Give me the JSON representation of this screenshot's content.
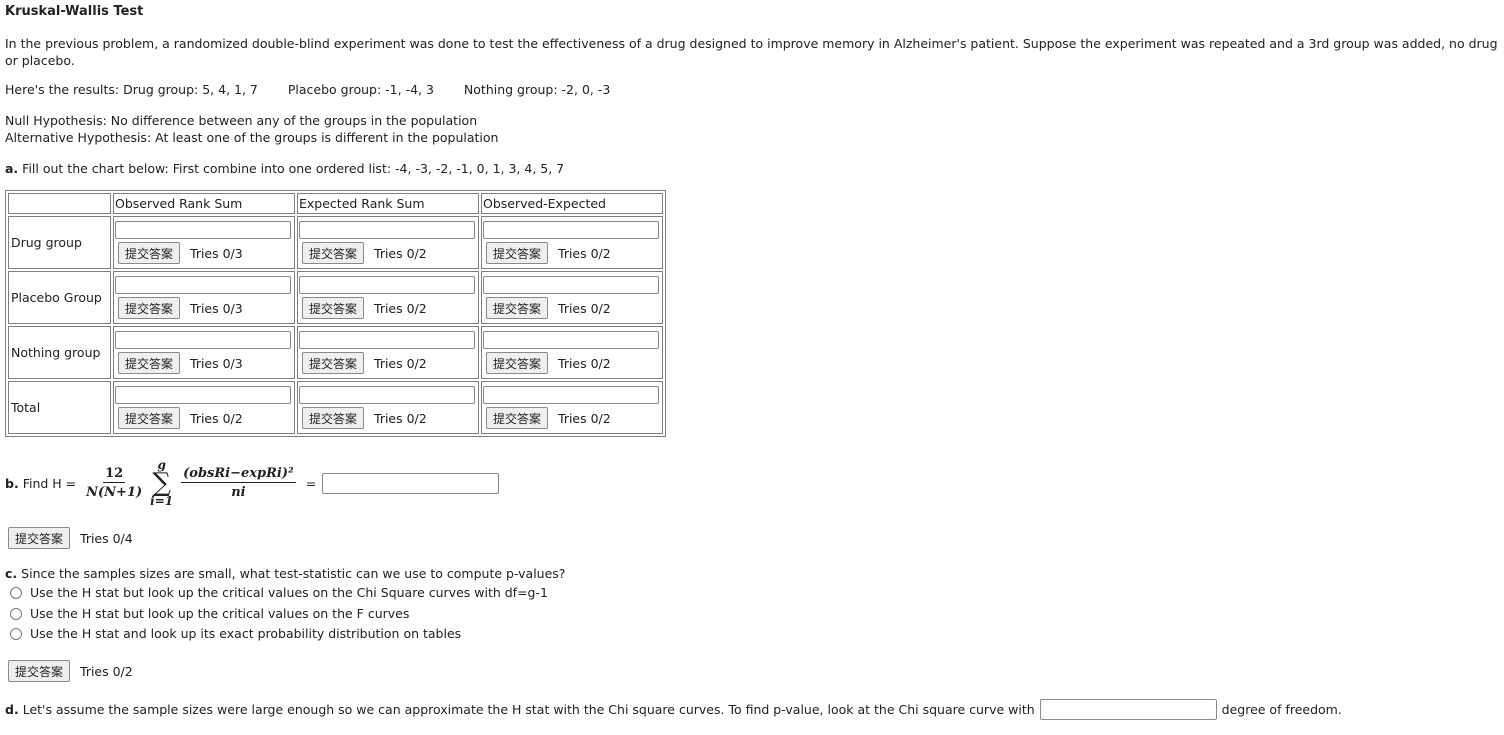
{
  "title": "Kruskal-Wallis Test",
  "intro": "In the previous problem, a randomized double-blind experiment was done to test the effectiveness of a drug designed to improve memory in Alzheimer's patient. Suppose the experiment was repeated and a 3rd group was added, no drug or placebo.",
  "results": {
    "prefix": "Here's the results:",
    "drug": "Drug group: 5, 4, 1, 7",
    "placebo": "Placebo group: -1, -4, 3",
    "nothing": "Nothing group: -2, 0, -3"
  },
  "hypotheses": {
    "null": "Null Hypothesis: No difference between any of the groups in the population",
    "alt": "Alternative Hypothesis: At least one of the groups is different in the population"
  },
  "part_a": {
    "label": "a.",
    "text": "Fill out the chart below: First combine into one ordered list: -4, -3, -2, -1, 0, 1, 3, 4, 5, 7",
    "columns": [
      "",
      "Observed Rank Sum",
      "Expected Rank Sum",
      "Observed-Expected"
    ],
    "rows": [
      {
        "label": "Drug group",
        "cells": [
          {
            "value": "",
            "tries": "Tries 0/3"
          },
          {
            "value": "",
            "tries": "Tries 0/2"
          },
          {
            "value": "",
            "tries": "Tries 0/2"
          }
        ]
      },
      {
        "label": "Placebo Group",
        "cells": [
          {
            "value": "",
            "tries": "Tries 0/3"
          },
          {
            "value": "",
            "tries": "Tries 0/2"
          },
          {
            "value": "",
            "tries": "Tries 0/2"
          }
        ]
      },
      {
        "label": "Nothing group",
        "cells": [
          {
            "value": "",
            "tries": "Tries 0/3"
          },
          {
            "value": "",
            "tries": "Tries 0/2"
          },
          {
            "value": "",
            "tries": "Tries 0/2"
          }
        ]
      },
      {
        "label": "Total",
        "cells": [
          {
            "value": "",
            "tries": "Tries 0/2"
          },
          {
            "value": "",
            "tries": "Tries 0/2"
          },
          {
            "value": "",
            "tries": "Tries 0/2"
          }
        ]
      }
    ]
  },
  "submit_label": "提交答案",
  "part_b": {
    "label": "b.",
    "text": "Find H =",
    "formula": {
      "frac_num": "12",
      "frac_den": "N(N+1)",
      "sum_upper": "g",
      "sum_lower": "i=1",
      "term_num": "(obsRi−expRi)²",
      "term_den": "ni"
    },
    "equals": "=",
    "value": "",
    "tries": "Tries 0/4"
  },
  "part_c": {
    "label": "c.",
    "text": "Since the samples sizes are small, what test-statistic can we use to compute p-values?",
    "options": [
      "Use the H stat but look up the critical values on the Chi Square curves with df=g-1",
      "Use the H stat but look up the critical values on the F curves",
      "Use the H stat and look up its exact probability distribution on tables"
    ],
    "tries": "Tries 0/2"
  },
  "part_d": {
    "label": "d.",
    "text": "Let's assume the sample sizes were large enough so we can approximate the H stat with the Chi square curves. To find p-value, look at the Chi square curve with",
    "value": "",
    "suffix": "degree of freedom."
  }
}
